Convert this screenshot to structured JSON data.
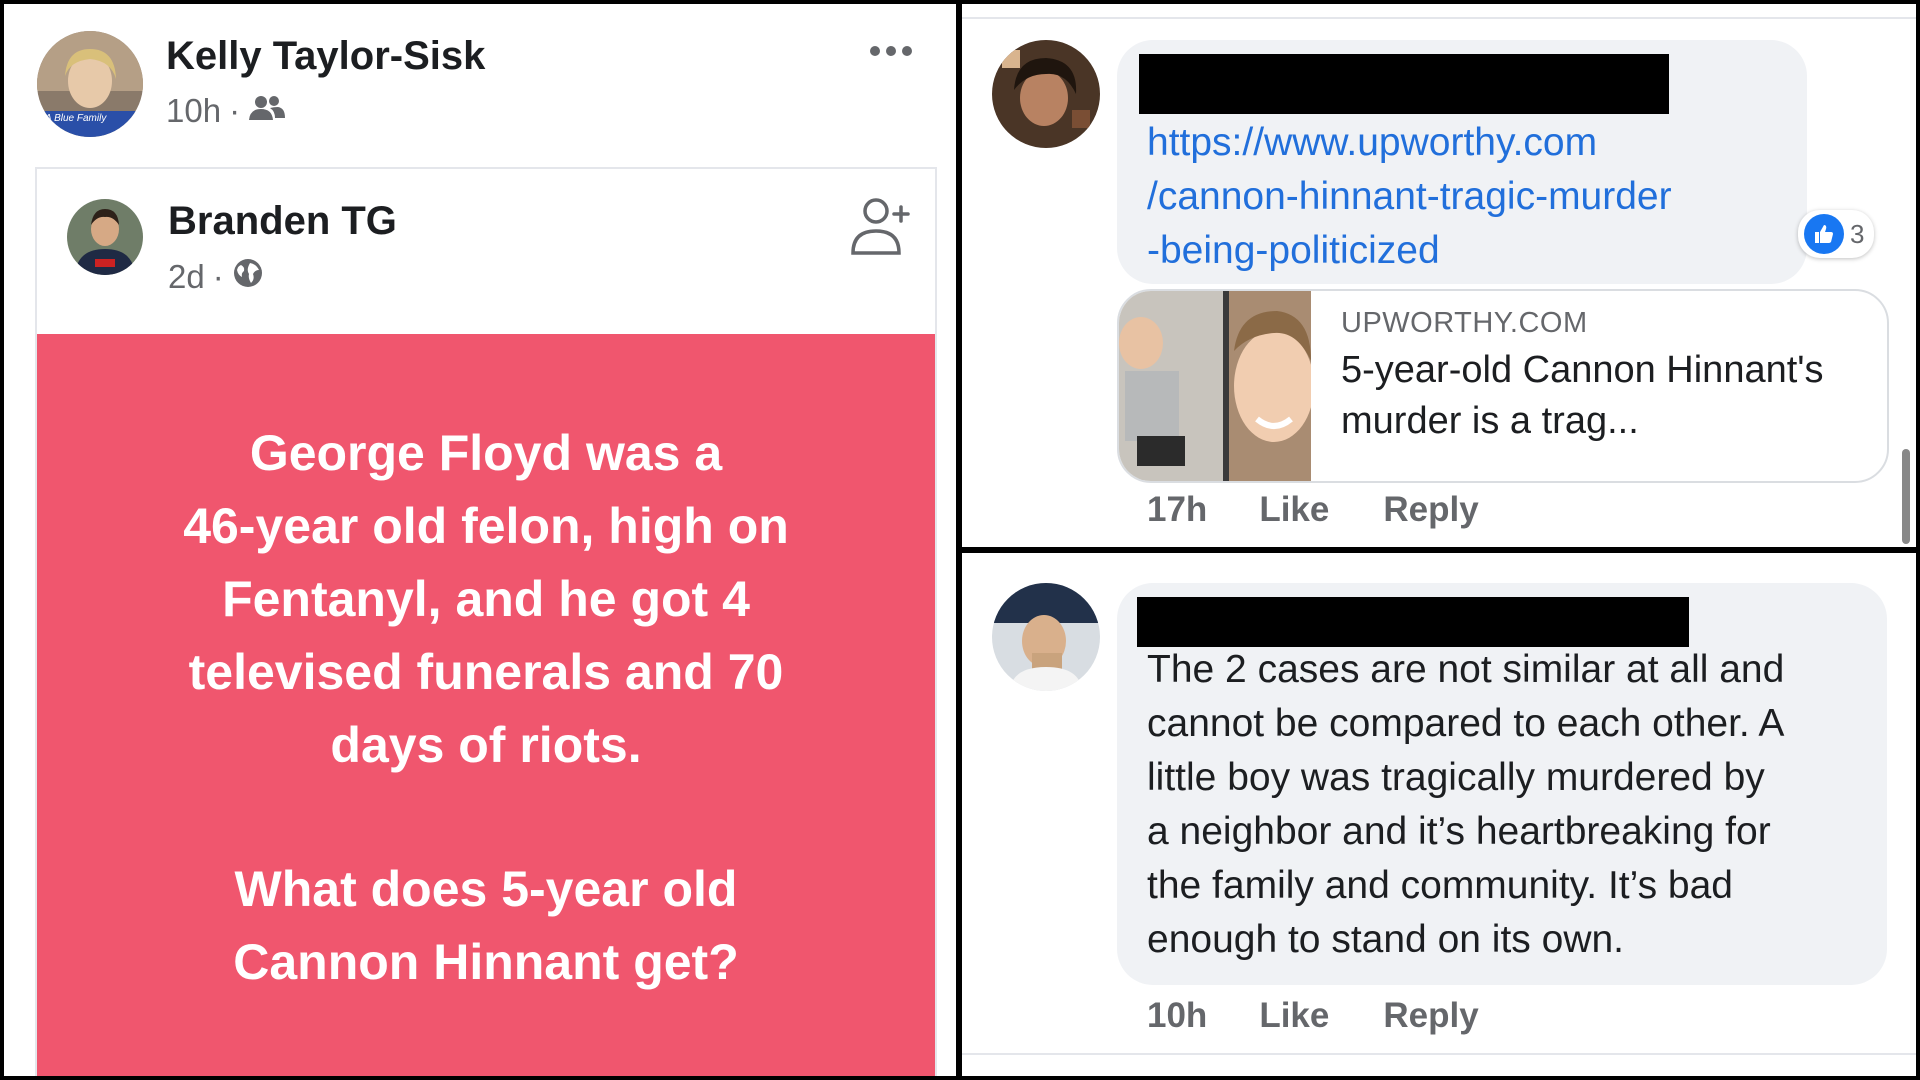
{
  "post": {
    "author": "Kelly Taylor-Sisk",
    "time": "10h",
    "audience_icon": "friends-icon",
    "avatar_caption": "A Blue Family",
    "shared": {
      "author": "Branden TG",
      "time": "2d",
      "audience_icon": "globe-icon",
      "background_color": "#f0566e",
      "text_lines": [
        "George Floyd was a",
        "46-year old felon, high on",
        "Fentanyl, and he got 4",
        "televised funerals and 70",
        "days of riots."
      ],
      "question_lines": [
        "What does 5-year old",
        "Cannon Hinnant get?"
      ]
    }
  },
  "comment1": {
    "link_lines": [
      "https://www.upworthy.com",
      "/cannon-hinnant-tragic-murder",
      "-being-politicized"
    ],
    "reaction_count": "3",
    "preview": {
      "domain": "UPWORTHY.COM",
      "title": "5-year-old Cannon Hinnant's murder is a trag..."
    },
    "time": "17h",
    "like": "Like",
    "reply": "Reply"
  },
  "comment2": {
    "text_lines": [
      "The 2 cases are not similar at all and",
      "cannot be compared to each other. A",
      "little boy was tragically murdered by",
      "a neighbor and it’s heartbreaking for",
      "the family and community. It’s bad",
      "enough to stand on its own."
    ],
    "time": "10h",
    "like": "Like",
    "reply": "Reply"
  }
}
